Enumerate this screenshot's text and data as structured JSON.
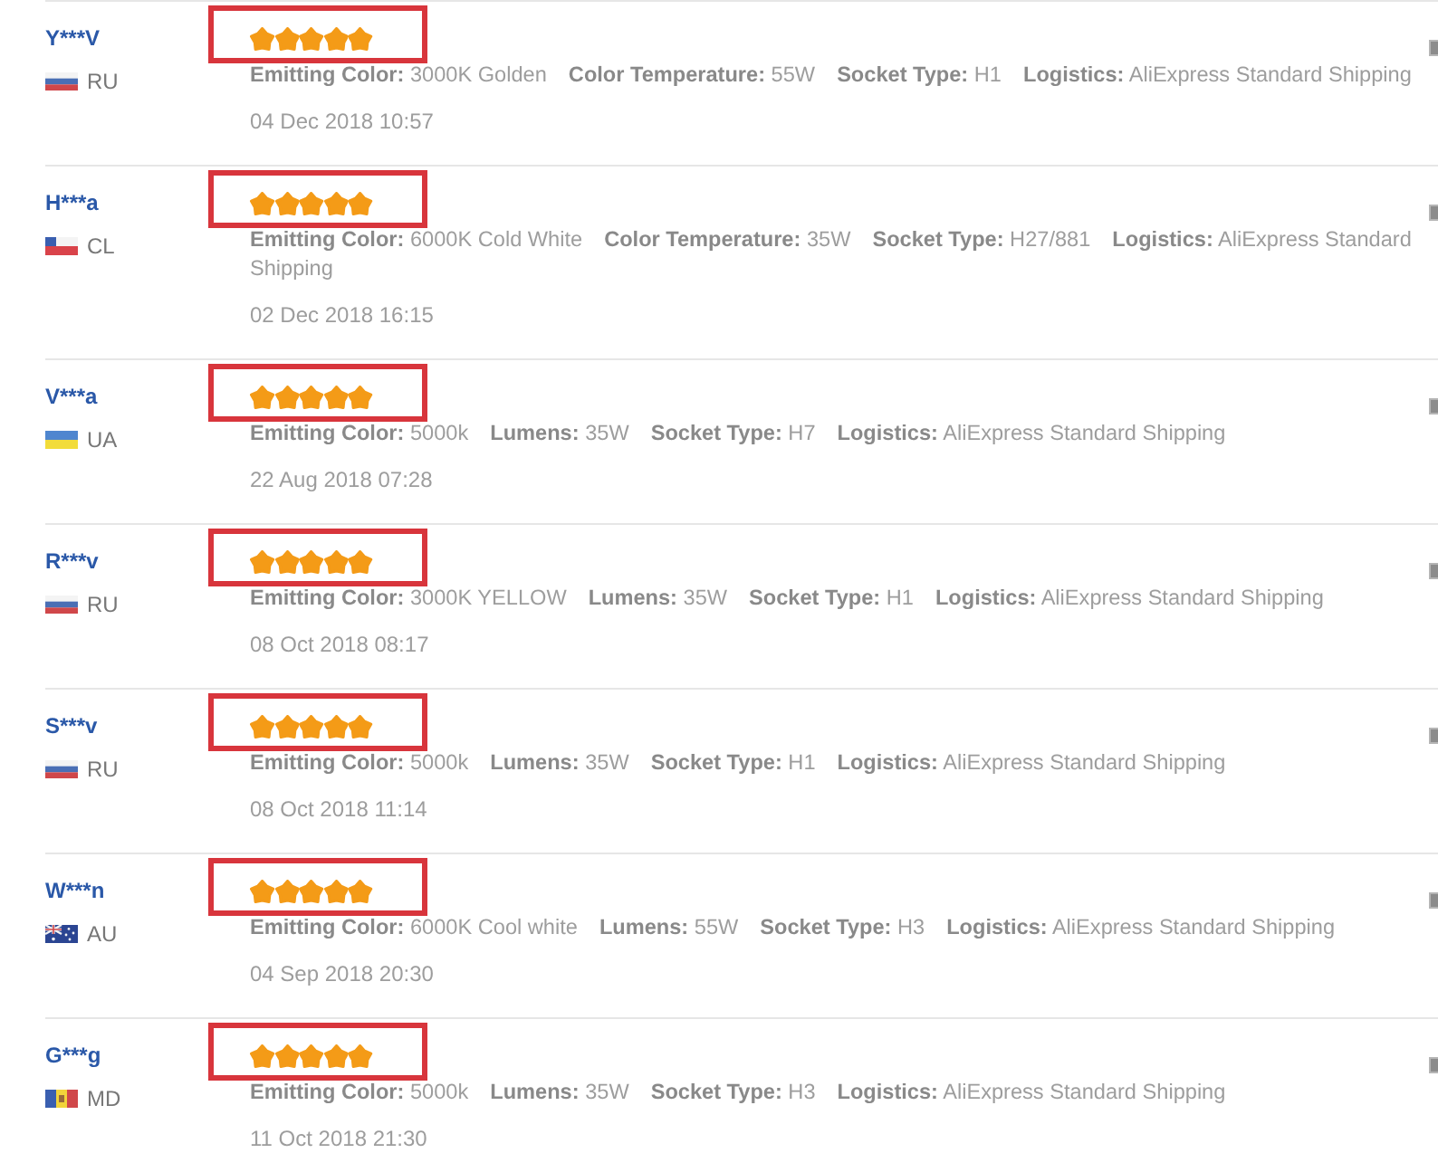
{
  "reviews": [
    {
      "user": "Y***V",
      "flag": {
        "kind": "ru"
      },
      "country": "RU",
      "stars": 5,
      "highlighted": true,
      "specs": [
        {
          "label": "Emitting Color:",
          "value": "3000K Golden"
        },
        {
          "label": "Color Temperature:",
          "value": "55W"
        },
        {
          "label": "Socket Type:",
          "value": "H1"
        },
        {
          "label": "Logistics:",
          "value": "AliExpress Standard Shipping"
        }
      ],
      "date": "04 Dec 2018 10:57"
    },
    {
      "user": "H***a",
      "flag": {
        "kind": "cl"
      },
      "country": "CL",
      "stars": 5,
      "highlighted": true,
      "specs": [
        {
          "label": "Emitting Color:",
          "value": "6000K Cold White"
        },
        {
          "label": "Color Temperature:",
          "value": "35W"
        },
        {
          "label": "Socket Type:",
          "value": "H27/881"
        },
        {
          "label": "Logistics:",
          "value": "AliExpress Standard Shipping"
        }
      ],
      "date": "02 Dec 2018 16:15"
    },
    {
      "user": "V***a",
      "flag": {
        "kind": "ua"
      },
      "country": "UA",
      "stars": 5,
      "highlighted": true,
      "specs": [
        {
          "label": "Emitting Color:",
          "value": "5000k"
        },
        {
          "label": "Lumens:",
          "value": "35W"
        },
        {
          "label": "Socket Type:",
          "value": "H7"
        },
        {
          "label": "Logistics:",
          "value": "AliExpress Standard Shipping"
        }
      ],
      "date": "22 Aug 2018 07:28"
    },
    {
      "user": "R***v",
      "flag": {
        "kind": "ru"
      },
      "country": "RU",
      "stars": 5,
      "highlighted": true,
      "specs": [
        {
          "label": "Emitting Color:",
          "value": "3000K YELLOW"
        },
        {
          "label": "Lumens:",
          "value": "35W"
        },
        {
          "label": "Socket Type:",
          "value": "H1"
        },
        {
          "label": "Logistics:",
          "value": "AliExpress Standard Shipping"
        }
      ],
      "date": "08 Oct 2018 08:17"
    },
    {
      "user": "S***v",
      "flag": {
        "kind": "ru"
      },
      "country": "RU",
      "stars": 5,
      "highlighted": true,
      "specs": [
        {
          "label": "Emitting Color:",
          "value": "5000k"
        },
        {
          "label": "Lumens:",
          "value": "35W"
        },
        {
          "label": "Socket Type:",
          "value": "H1"
        },
        {
          "label": "Logistics:",
          "value": "AliExpress Standard Shipping"
        }
      ],
      "date": "08 Oct 2018 11:14"
    },
    {
      "user": "W***n",
      "flag": {
        "kind": "au"
      },
      "country": "AU",
      "stars": 5,
      "highlighted": true,
      "specs": [
        {
          "label": "Emitting Color:",
          "value": "6000K Cool white"
        },
        {
          "label": "Lumens:",
          "value": "55W"
        },
        {
          "label": "Socket Type:",
          "value": "H3"
        },
        {
          "label": "Logistics:",
          "value": "AliExpress Standard Shipping"
        }
      ],
      "date": "04 Sep 2018 20:30"
    },
    {
      "user": "G***g",
      "flag": {
        "kind": "md"
      },
      "country": "MD",
      "stars": 5,
      "highlighted": true,
      "specs": [
        {
          "label": "Emitting Color:",
          "value": "5000k"
        },
        {
          "label": "Lumens:",
          "value": "35W"
        },
        {
          "label": "Socket Type:",
          "value": "H3"
        },
        {
          "label": "Logistics:",
          "value": "AliExpress Standard Shipping"
        }
      ],
      "date": "11 Oct 2018 21:30"
    }
  ]
}
